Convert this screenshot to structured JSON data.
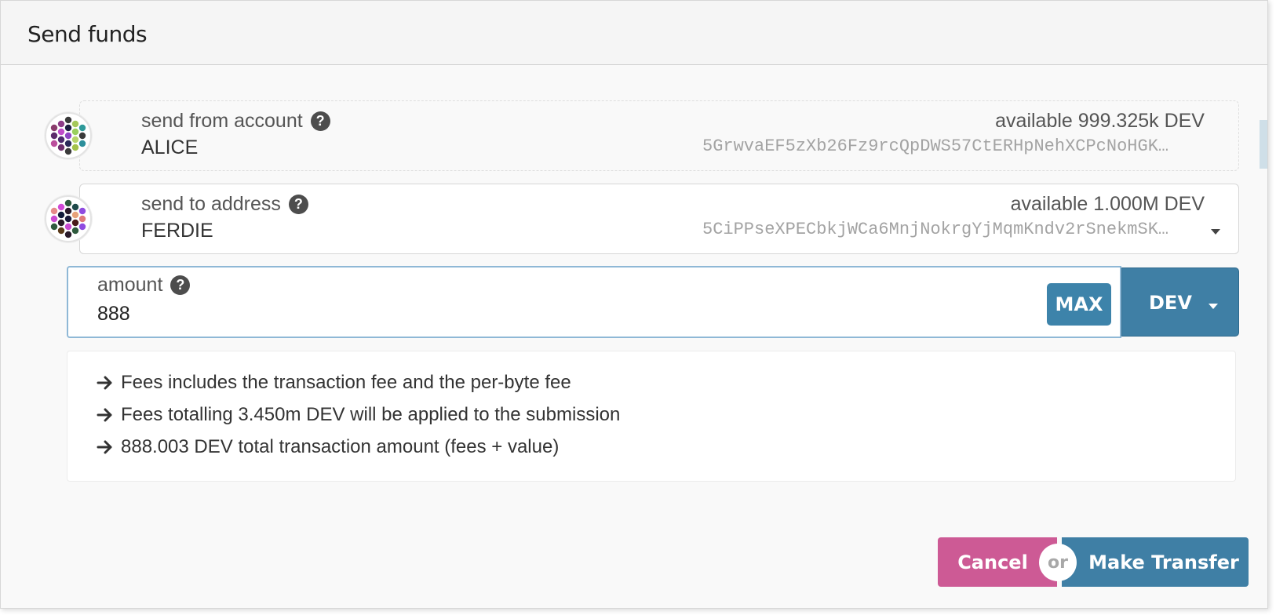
{
  "modal": {
    "title": "Send funds"
  },
  "from": {
    "label": "send from account",
    "name": "ALICE",
    "available": "available 999.325k DEV",
    "address": "5GrwvaEF5zXb26Fz9rcQpDWS57CtERHpNehXCPcNoHGK…"
  },
  "to": {
    "label": "send to address",
    "name": "FERDIE",
    "available": "available 1.000M DEV",
    "address": "5CiPPseXPECbkjWCa6MnjNokrgYjMqmKndv2rSnekmSK…"
  },
  "amount": {
    "label": "amount",
    "value": "888",
    "max_label": "MAX",
    "unit": "DEV"
  },
  "fees": [
    "Fees includes the transaction fee and the per-byte fee",
    "Fees totalling 3.450m DEV will be applied to the submission",
    "888.003 DEV total transaction amount (fees + value)"
  ],
  "actions": {
    "cancel_label": "Cancel",
    "or_label": "or",
    "transfer_label": "Make Transfer"
  },
  "icons": {
    "help": "question-circle-icon",
    "arrow": "arrow-right-icon",
    "dropdown": "caret-down-icon"
  },
  "colors": {
    "primary": "#3f7fa5",
    "cancel": "#cd5a95"
  }
}
